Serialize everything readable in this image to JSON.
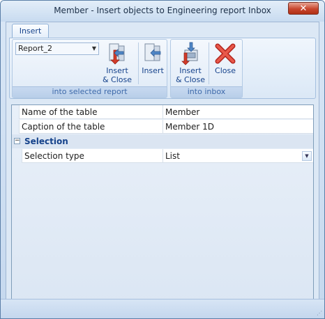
{
  "window": {
    "title": "Member - Insert objects to Engineering report Inbox",
    "close_glyph": "✕"
  },
  "ribbon": {
    "tab": "Insert",
    "report_combo": {
      "value": "Report_2",
      "arrow": "▼"
    },
    "group1": {
      "label": "into selected report",
      "buttons": [
        {
          "label_line1": "Insert",
          "label_line2": "& Close",
          "icon": "insert-close-icon"
        },
        {
          "label_line1": "Insert",
          "label_line2": "",
          "icon": "insert-icon"
        }
      ]
    },
    "group2": {
      "label": "into inbox",
      "buttons": [
        {
          "label_line1": "Insert",
          "label_line2": "& Close",
          "icon": "inbox-insert-close-icon"
        },
        {
          "label_line1": "Close",
          "label_line2": "",
          "icon": "close-red-x-icon"
        }
      ]
    }
  },
  "properties": {
    "rows": [
      {
        "name": "Name of the table",
        "value": "Member"
      },
      {
        "name": "Caption of the table",
        "value": "Member 1D"
      }
    ],
    "category": {
      "toggle": "−",
      "title": "Selection"
    },
    "selection_rows": [
      {
        "name": "Selection type",
        "value": "List",
        "dropdown": "▼"
      }
    ]
  },
  "status": {
    "grip": "⋰"
  },
  "colors": {
    "accent": "#15428b",
    "close_red": "#c8462e"
  }
}
